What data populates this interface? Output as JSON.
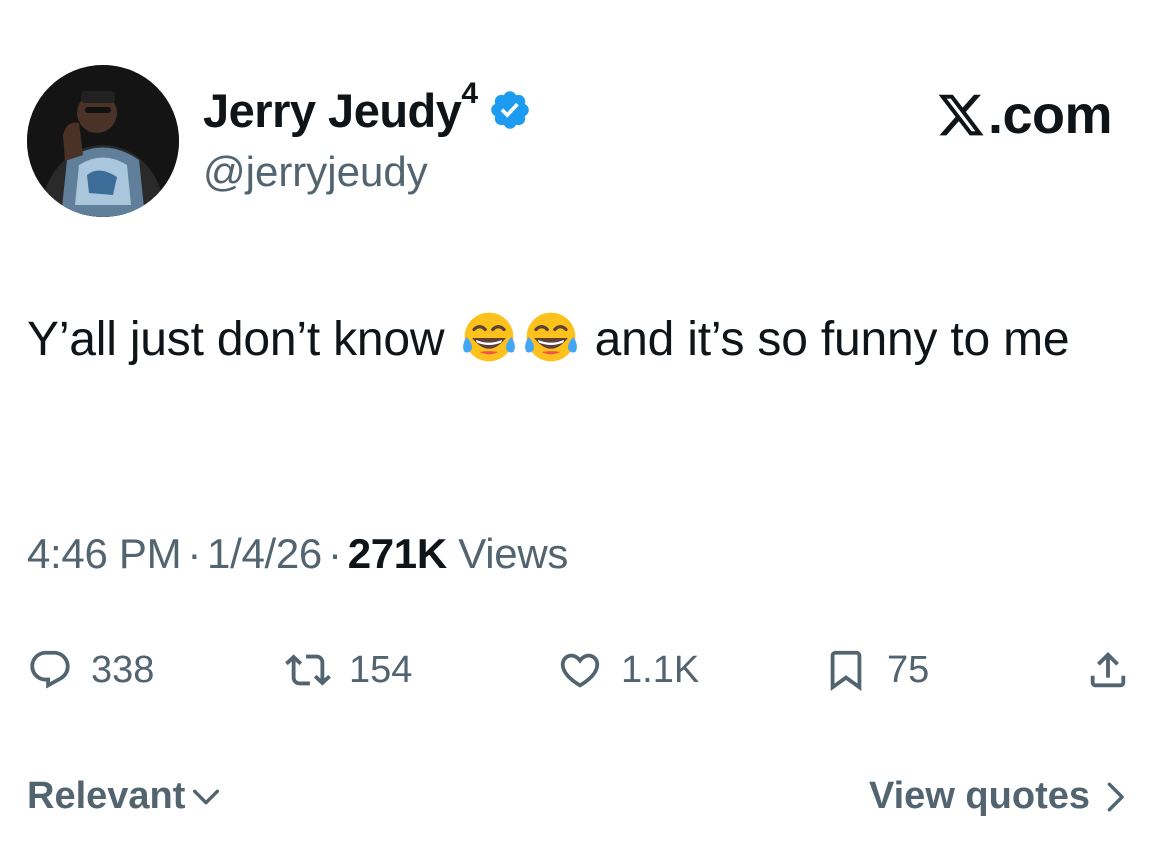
{
  "author": {
    "display_name": "Jerry Jeudy",
    "name_superscript": "4",
    "handle": "@jerryjeudy",
    "verified_icon": "verified-badge-icon",
    "verified_color": "#1d9bf0"
  },
  "brand": {
    "label": ".com",
    "icon": "x-logo-icon"
  },
  "tweet": {
    "text_before": "Y’all just don’t know",
    "emoji": "face-with-tears-of-joy",
    "text_after": "and it’s so funny to me"
  },
  "meta": {
    "time": "4:46 PM",
    "date": "1/4/26",
    "separator": "·",
    "views_count": "271K",
    "views_label": "Views"
  },
  "actions": {
    "reply_count": "338",
    "repost_count": "154",
    "like_count": "1.1K",
    "bookmark_count": "75"
  },
  "footer": {
    "sort_label": "Relevant",
    "quotes_label": "View quotes"
  },
  "colors": {
    "text_primary": "#0f1419",
    "text_secondary": "#536471",
    "accent": "#1d9bf0"
  }
}
